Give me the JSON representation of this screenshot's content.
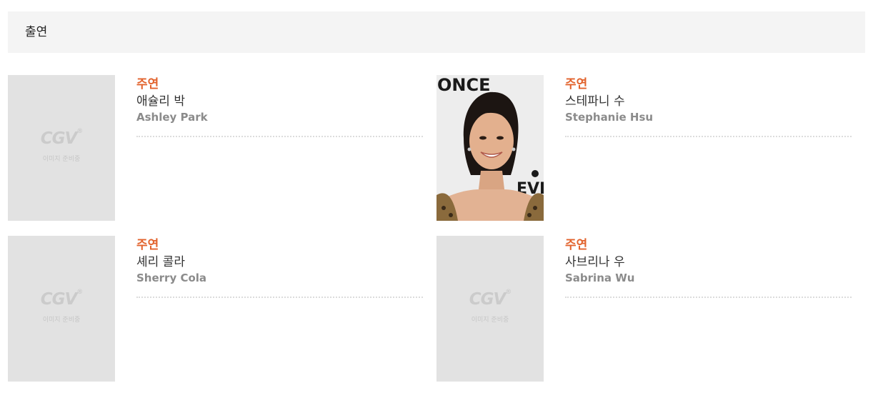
{
  "section": {
    "title": "출연"
  },
  "placeholder": {
    "logo_text": "CGV",
    "logo_mark": "®",
    "caption": "이미지 준비중"
  },
  "cast": [
    {
      "role": "주연",
      "name_ko": "애슐리 박",
      "name_en": "Ashley Park",
      "has_photo": false
    },
    {
      "role": "주연",
      "name_ko": "스테파니 수",
      "name_en": "Stephanie Hsu",
      "has_photo": true,
      "photo_text": [
        "ONCE",
        "EVE"
      ]
    },
    {
      "role": "주연",
      "name_ko": "셰리 콜라",
      "name_en": "Sherry Cola",
      "has_photo": false
    },
    {
      "role": "주연",
      "name_ko": "사브리나 우",
      "name_en": "Sabrina Wu",
      "has_photo": false
    }
  ],
  "colors": {
    "role": "#e2632d",
    "header_bg": "#f4f4f4",
    "placeholder_bg": "#e2e2e2"
  }
}
